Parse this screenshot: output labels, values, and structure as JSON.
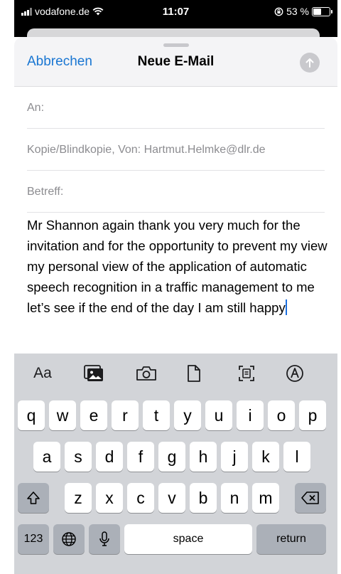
{
  "status_bar": {
    "carrier": "vodafone.de",
    "time": "11:07",
    "battery_text": "53 %",
    "battery_level": 0.53,
    "icons": [
      "signal-icon",
      "wifi-icon",
      "orientation-lock-icon",
      "battery-icon"
    ]
  },
  "compose": {
    "cancel_label": "Abbrechen",
    "title": "Neue E-Mail",
    "send_icon": "arrow-up-icon",
    "to_label": "An:",
    "cc_label": "Kopie/Blindkopie, Von:",
    "from_value": "Hartmut.Helmke@dlr.de",
    "subject_label": "Betreff:",
    "body": "Mr Shannon again thank you very much for the invitation and for the opportunity to prevent my view my personal view of the application of automatic speech recognition in a traffic management to me let’s see if the end of the day I am still happy"
  },
  "keyboard": {
    "toolbar": {
      "format_label": "Aa",
      "icons": [
        "photo-library-icon",
        "camera-icon",
        "document-icon",
        "scan-document-icon",
        "markup-icon"
      ]
    },
    "row1": [
      "q",
      "w",
      "e",
      "r",
      "t",
      "y",
      "u",
      "i",
      "o",
      "p"
    ],
    "row2": [
      "a",
      "s",
      "d",
      "f",
      "g",
      "h",
      "j",
      "k",
      "l"
    ],
    "row3": [
      "z",
      "x",
      "c",
      "v",
      "b",
      "n",
      "m"
    ],
    "numbers_label": "123",
    "space_label": "space",
    "return_label": "return"
  }
}
